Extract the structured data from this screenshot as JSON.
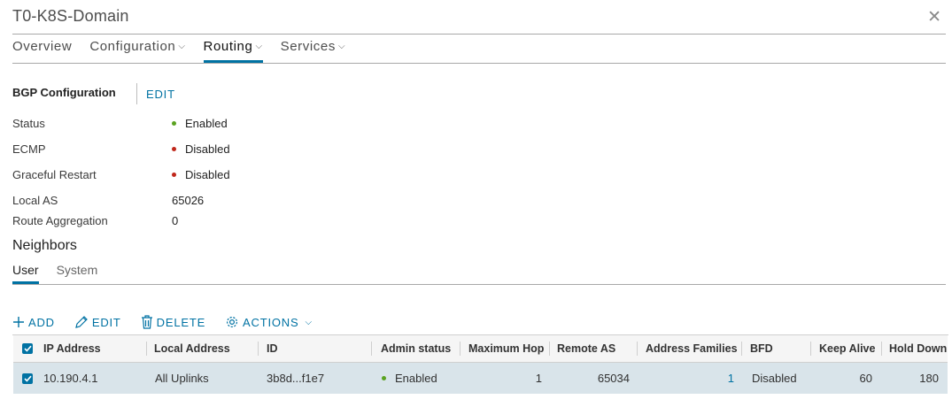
{
  "window": {
    "title": "T0-K8S-Domain"
  },
  "tabs": [
    {
      "label": "Overview",
      "dropdown": false
    },
    {
      "label": "Configuration",
      "dropdown": true
    },
    {
      "label": "Routing",
      "dropdown": true,
      "active": true
    },
    {
      "label": "Services",
      "dropdown": true
    }
  ],
  "bgp": {
    "heading": "BGP Configuration",
    "edit_label": "EDIT",
    "properties": [
      {
        "label": "Status",
        "value": "Enabled",
        "indicator": "green"
      },
      {
        "label": "ECMP",
        "value": "Disabled",
        "indicator": "red"
      },
      {
        "label": "Graceful Restart",
        "value": "Disabled",
        "indicator": "red"
      },
      {
        "label": "Local AS",
        "value": "65026"
      },
      {
        "label": "Route Aggregation",
        "value": "0"
      }
    ]
  },
  "neighbors": {
    "heading": "Neighbors",
    "subtabs": [
      {
        "label": "User",
        "active": true
      },
      {
        "label": "System"
      }
    ],
    "toolbar": {
      "add": "ADD",
      "edit": "EDIT",
      "delete": "DELETE",
      "actions": "ACTIONS"
    },
    "columns": {
      "ip": "IP Address",
      "local": "Local Address",
      "id": "ID",
      "admin": "Admin status",
      "maxhop": "Maximum Hop",
      "remote_as": "Remote AS",
      "families": "Address Families",
      "bfd": "BFD",
      "keepalive": "Keep Alive",
      "holddown": "Hold Down"
    },
    "rows": [
      {
        "ip": "10.190.4.1",
        "local": "All Uplinks",
        "id": "3b8d...f1e7",
        "admin": "Enabled",
        "maxhop": "1",
        "remote_as": "65034",
        "families": "1",
        "bfd": "Disabled",
        "keepalive": "60",
        "holddown": "180",
        "selected": true
      }
    ]
  },
  "colors": {
    "accent": "#0072a3",
    "enabled": "#5aa220",
    "disabled": "#c0271b",
    "selected_row": "#d9e4ea"
  }
}
